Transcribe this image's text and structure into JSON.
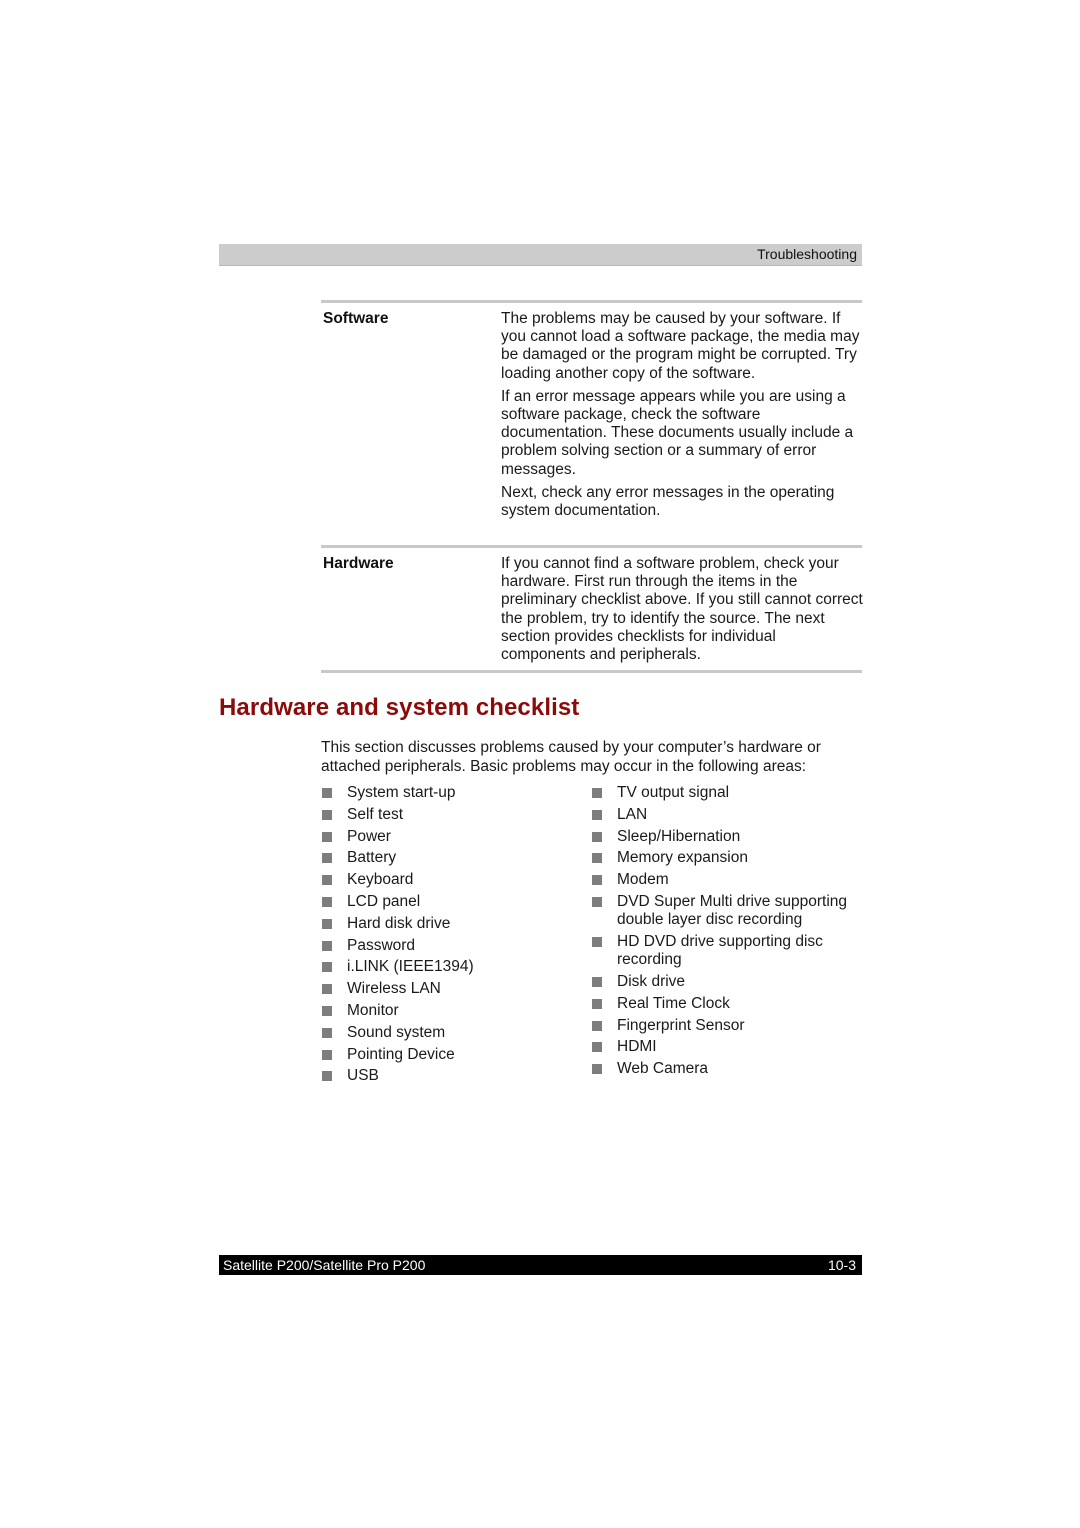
{
  "header": {
    "section": "Troubleshooting"
  },
  "definitions": [
    {
      "term": "Software",
      "paragraphs": [
        "The problems may be caused by your software. If you cannot load a software package, the media may be damaged or the program might be corrupted. Try loading another copy of the software.",
        "If an error message appears while you are using a software package, check the software documentation. These documents usually include a problem solving section or a summary of error messages.",
        "Next, check any error messages in the operating system documentation."
      ]
    },
    {
      "term": "Hardware",
      "paragraphs": [
        "If you cannot find a software problem, check your hardware. First run through the items in the preliminary checklist above. If you still cannot correct the problem, try to identify the source. The next section provides checklists for individual components and peripherals."
      ]
    }
  ],
  "section": {
    "title": "Hardware and system checklist",
    "intro": "This section discusses problems caused by your computer’s hardware or attached peripherals. Basic problems may occur in the following areas:",
    "list_left": [
      "System start-up",
      "Self test",
      "Power",
      "Battery",
      "Keyboard",
      "LCD panel",
      "Hard disk drive",
      "Password",
      "i.LINK (IEEE1394)",
      "Wireless LAN",
      "Monitor",
      "Sound system",
      "Pointing Device",
      "USB"
    ],
    "list_right": [
      "TV output signal",
      "LAN",
      "Sleep/Hibernation",
      "Memory expansion",
      "Modem",
      "DVD Super Multi drive supporting double layer disc recording",
      "HD DVD drive supporting disc recording",
      "Disk drive",
      "Real Time  Clock",
      "Fingerprint Sensor",
      "HDMI",
      "Web Camera"
    ]
  },
  "footer": {
    "product": "Satellite P200/Satellite Pro P200",
    "page_number": "10-3"
  },
  "colors": {
    "heading": "#8b0a0a",
    "header_bar": "#cccccc",
    "footer_bar": "#000000",
    "bullet": "#7d7d7d",
    "rule": "#c8c8c8"
  }
}
